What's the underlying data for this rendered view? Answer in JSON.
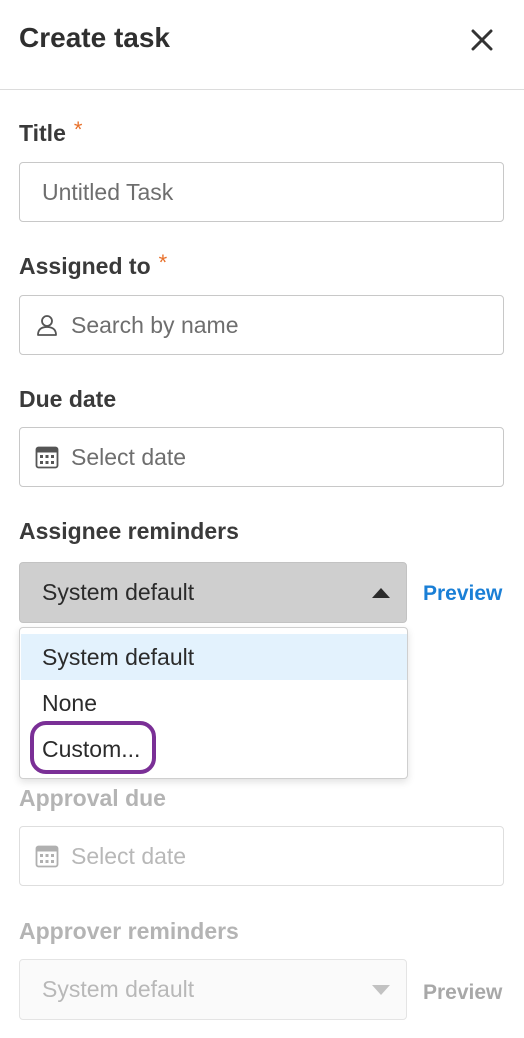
{
  "header": {
    "title": "Create task"
  },
  "title_field": {
    "label": "Title",
    "required": "*",
    "placeholder": "Untitled Task"
  },
  "assigned_field": {
    "label": "Assigned to",
    "required": "*",
    "placeholder": "Search by name",
    "icon": "person-icon"
  },
  "due_field": {
    "label": "Due date",
    "placeholder": "Select date",
    "icon": "calendar-icon"
  },
  "assignee_reminders": {
    "label": "Assignee reminders",
    "selected": "System default",
    "preview": "Preview",
    "options": [
      "System default",
      "None",
      "Custom..."
    ]
  },
  "approval_due": {
    "label": "Approval due",
    "placeholder": "Select date",
    "icon": "calendar-icon"
  },
  "approver_reminders": {
    "label": "Approver reminders",
    "selected": "System default",
    "preview": "Preview"
  },
  "colors": {
    "accent_link": "#1a7fd6",
    "disabled_link": "#a8a8a8",
    "required": "#e8702a",
    "highlight": "#7a2f96",
    "selected_option_bg": "#e3f2fd"
  }
}
